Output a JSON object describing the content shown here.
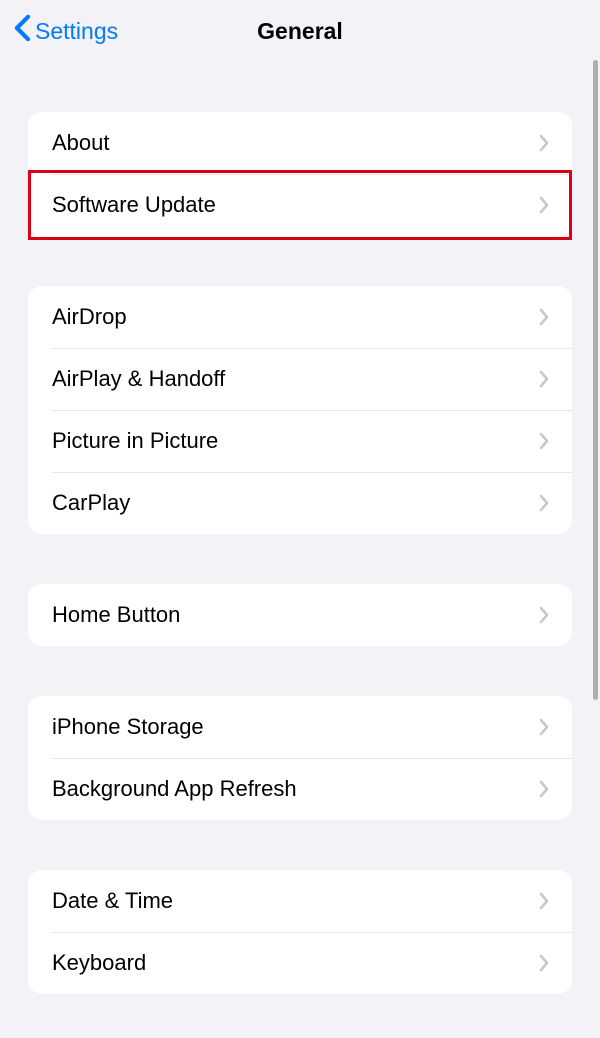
{
  "header": {
    "back_label": "Settings",
    "title": "General"
  },
  "groups": [
    {
      "id": "g1",
      "items": [
        "About",
        "Software Update"
      ],
      "highlight_index": 1
    },
    {
      "id": "g2",
      "items": [
        "AirDrop",
        "AirPlay & Handoff",
        "Picture in Picture",
        "CarPlay"
      ]
    },
    {
      "id": "g3",
      "items": [
        "Home Button"
      ]
    },
    {
      "id": "g4",
      "items": [
        "iPhone Storage",
        "Background App Refresh"
      ]
    },
    {
      "id": "g5",
      "items": [
        "Date & Time",
        "Keyboard"
      ]
    }
  ],
  "colors": {
    "accent": "#007aff",
    "highlight": "#d9001b",
    "background": "#f2f2f7"
  }
}
